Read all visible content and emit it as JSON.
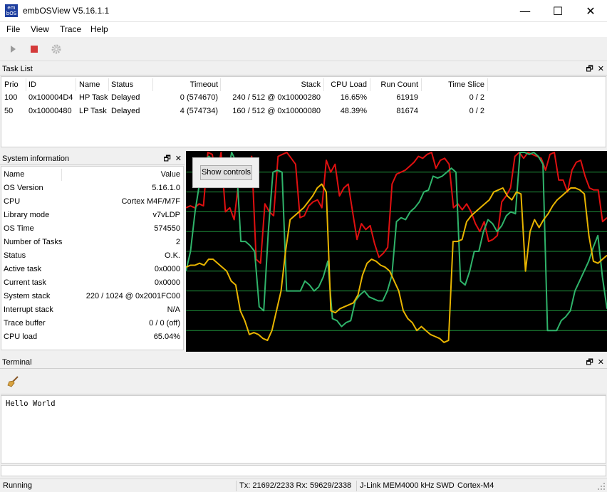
{
  "window": {
    "title": "embOSView V5.16.1.1",
    "icon_text": "em bOS",
    "minimize": "—",
    "maximize": "☐",
    "close": "✕"
  },
  "menu": [
    "File",
    "View",
    "Trace",
    "Help"
  ],
  "toolbar": {
    "icons": [
      "play-icon",
      "stop-icon",
      "gear-icon"
    ]
  },
  "panels": {
    "task_list": "Task List",
    "system_info": "System information",
    "terminal": "Terminal",
    "dock_float": "🗗",
    "dock_close": "✕"
  },
  "task_table": {
    "headers": [
      "Prio",
      "ID",
      "Name",
      "Status",
      "Timeout",
      "Stack",
      "CPU Load",
      "Run Count",
      "Time Slice"
    ],
    "rows": [
      [
        "100",
        "0x100004D4",
        "HP Task",
        "Delayed",
        "0 (574670)",
        "240 / 512 @ 0x10000280",
        "16.65%",
        "61919",
        "0 / 2"
      ],
      [
        "50",
        "0x10000480",
        "LP Task",
        "Delayed",
        "4 (574734)",
        "160 / 512 @ 0x10000080",
        "48.39%",
        "81674",
        "0 / 2"
      ]
    ]
  },
  "system_info": {
    "header": [
      "Name",
      "Value"
    ],
    "rows": [
      [
        "OS Version",
        "5.16.1.0"
      ],
      [
        "CPU",
        "Cortex M4F/M7F"
      ],
      [
        "Library mode",
        "v7vLDP"
      ],
      [
        "OS Time",
        "574550"
      ],
      [
        "Number of Tasks",
        "2"
      ],
      [
        "Status",
        "O.K."
      ],
      [
        "Active task",
        "0x0000"
      ],
      [
        "Current task",
        "0x0000"
      ],
      [
        "System stack",
        "220 / 1024 @ 0x2001FC00"
      ],
      [
        "Interrupt stack",
        "N/A"
      ],
      [
        "Trace buffer",
        "0 / 0 (off)"
      ],
      [
        "CPU load",
        "65.04%"
      ]
    ]
  },
  "graph": {
    "show_controls_label": "Show controls"
  },
  "chart_data": {
    "type": "line",
    "ylim": [
      0,
      100
    ],
    "grid": true,
    "colors": {
      "red": "#e01010",
      "green": "#2fb36a",
      "yellow": "#e8b400",
      "grid": "#1e8f3a"
    },
    "series": [
      {
        "color": "red",
        "values": [
          72,
          73,
          72,
          74,
          73,
          100,
          99,
          88,
          100,
          70,
          72,
          66,
          85,
          89,
          93,
          98,
          46,
          44,
          74,
          70,
          68,
          98,
          99,
          100,
          97,
          94,
          67,
          68,
          73,
          75,
          76,
          72,
          96,
          90,
          94,
          78,
          82,
          84,
          70,
          56,
          64,
          61,
          63,
          54,
          47,
          49,
          52,
          84,
          89,
          90,
          91,
          93,
          95,
          98,
          97,
          99,
          100,
          92,
          96,
          97,
          94,
          72,
          74,
          71,
          74,
          70,
          64,
          60,
          65,
          55,
          56,
          58,
          75,
          78,
          82,
          98,
          100,
          97,
          100,
          99,
          98,
          97,
          91,
          99,
          100,
          86,
          86,
          80,
          91,
          95,
          96,
          88,
          82,
          81,
          81,
          65,
          67
        ]
      },
      {
        "color": "green",
        "values": [
          40,
          50,
          70,
          85,
          96,
          98,
          96,
          92,
          91,
          88,
          100,
          95,
          55,
          55,
          53,
          50,
          22,
          20,
          60,
          90,
          91,
          90,
          30,
          30,
          30,
          30,
          35,
          33,
          30,
          32,
          37,
          45,
          16,
          15,
          12,
          14,
          15,
          25,
          28,
          30,
          27,
          26,
          25,
          25,
          30,
          38,
          65,
          67,
          66,
          70,
          72,
          75,
          80,
          81,
          88,
          87,
          88,
          90,
          92,
          90,
          35,
          33,
          40,
          50,
          50,
          60,
          66,
          64,
          60,
          63,
          68,
          70,
          69,
          100,
          100,
          99,
          100,
          98,
          94,
          10,
          10,
          10,
          15,
          17,
          20,
          30,
          35,
          40,
          45,
          52,
          58,
          37,
          21
        ]
      },
      {
        "color": "yellow",
        "values": [
          42,
          43,
          43,
          44,
          43,
          46,
          46,
          44,
          42,
          40,
          35,
          33,
          20,
          15,
          8,
          9,
          8,
          6,
          5,
          10,
          20,
          30,
          50,
          66,
          68,
          70,
          72,
          75,
          78,
          82,
          84,
          80,
          20,
          19,
          21,
          22,
          23,
          24,
          28,
          38,
          44,
          46,
          45,
          43,
          42,
          40,
          35,
          30,
          20,
          16,
          14,
          10,
          12,
          10,
          8,
          7,
          6,
          4,
          5,
          55,
          55,
          56,
          65,
          68,
          70,
          72,
          74,
          76,
          80,
          81,
          82,
          78,
          76,
          80,
          79,
          40,
          60,
          66,
          62,
          66,
          69,
          73,
          76,
          78,
          80,
          82,
          82,
          81,
          79,
          58,
          45,
          44,
          46,
          48
        ]
      }
    ]
  },
  "terminal": {
    "output": "Hello World",
    "clear_icon": "broom-icon"
  },
  "status": {
    "state": "Running",
    "txrx": "Tx: 21692/2233 Rx: 59629/2338",
    "conn": "J-Link MEM",
    "speed": "4000 kHz",
    "iface": "SWD",
    "core": "Cortex-M4"
  }
}
